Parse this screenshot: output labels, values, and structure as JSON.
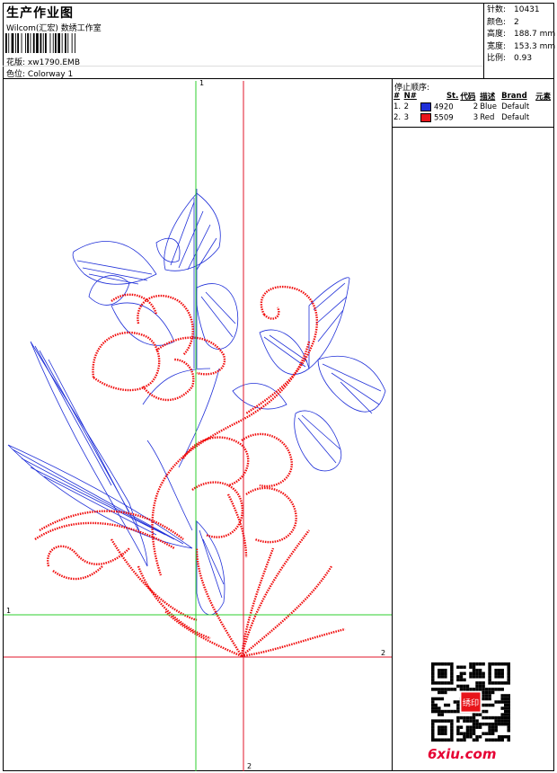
{
  "header": {
    "title": "生产作业图",
    "company": "Wilcom(汇宏) 数绣工作室",
    "design_label": "花版:",
    "design_file": "xw1790.EMB",
    "colorway_label": "色位:",
    "colorway": "Colorway 1"
  },
  "stats": [
    {
      "label": "针数:",
      "value": "10431"
    },
    {
      "label": "颜色:",
      "value": "2"
    },
    {
      "label": "高度:",
      "value": "188.7 mm"
    },
    {
      "label": "宽度:",
      "value": "153.3 mm"
    },
    {
      "label": "比例:",
      "value": "0.93"
    }
  ],
  "stop_sequence": {
    "title": "停止顺序:",
    "headers": [
      "#",
      "N#",
      "St.",
      "代码",
      "描述",
      "Brand",
      "元素"
    ],
    "rows": [
      {
        "num": "1.",
        "n": "2",
        "color": "#1f2fd8",
        "code": "4920",
        "st": "2",
        "desc": "Blue",
        "brand": "Default"
      },
      {
        "num": "2.",
        "n": "3",
        "color": "#e8141a",
        "code": "5509",
        "st": "3",
        "desc": "Red",
        "brand": "Default"
      }
    ]
  },
  "guides": {
    "green_label": "1",
    "red_label": "2",
    "green_color": "#2ccf2c",
    "red_color": "#e2142a"
  },
  "thread_colors": {
    "blue": "#1f2fd8",
    "red": "#f00a0a"
  },
  "watermark": {
    "brand": "6xiu.com",
    "stamp": "绣印"
  }
}
